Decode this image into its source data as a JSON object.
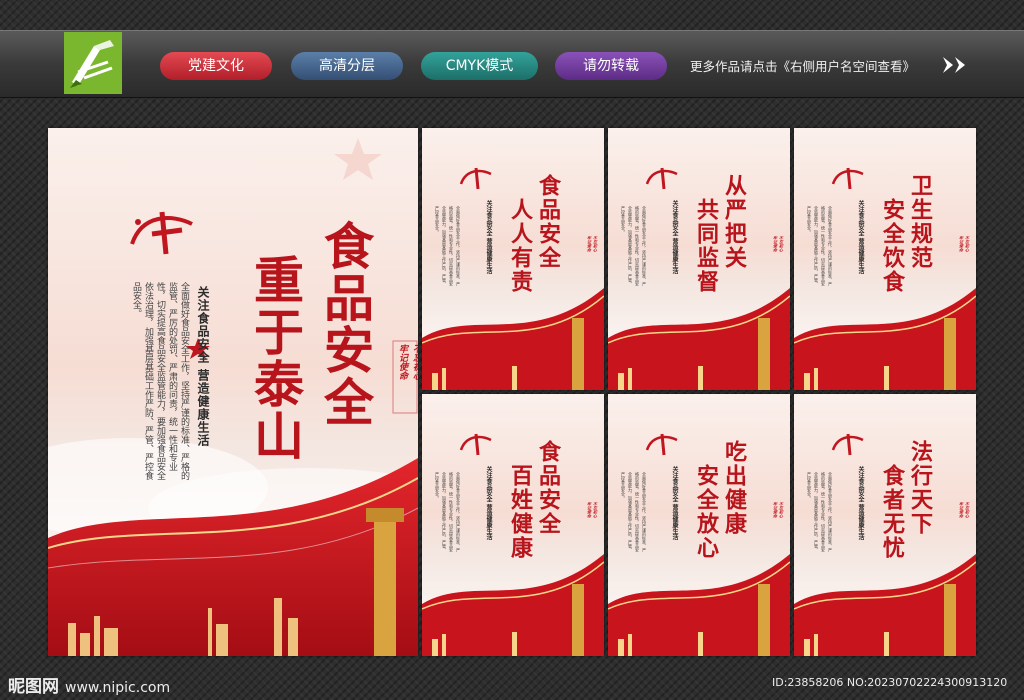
{
  "header": {
    "tags": [
      "党建文化",
      "高清分层",
      "CMYK模式",
      "请勿转载"
    ],
    "more_text": "更多作品请点击《右侧用户名空间查看》",
    "colors": {
      "tag1": "#c42a33",
      "tag2": "#4a6a91",
      "tag3": "#279088",
      "tag4": "#743f9f",
      "logo": "#7ab72f"
    }
  },
  "main_poster": {
    "title_line1": "食品安全",
    "title_line2": "重于泰山",
    "subtitle": "关注食品安全 营造健康生活",
    "body": "全面做好食品安全工作，坚持严谨的标准、严格的监管、严厉的处罚、严肃的问责，统一性和专业性，切实提高食品安全监管能力，要加强食品安全依法治理，加强基层基础工作严防、严管、严控食品安全。",
    "seal_left": "不忘初心",
    "seal_right": "牢记使命"
  },
  "small_posters": [
    {
      "line1": "食品安全",
      "line2": "人人有责"
    },
    {
      "line1": "从严把关",
      "line2": "共同监督"
    },
    {
      "line1": "卫生规范",
      "line2": "安全饮食"
    },
    {
      "line1": "食品安全",
      "line2": "百姓健康"
    },
    {
      "line1": "吃出健康",
      "line2": "安全放心"
    },
    {
      "line1": "法行天下",
      "line2": "食者无忧"
    }
  ],
  "small_common": {
    "subtitle": "关注食品安全 营造健康生活",
    "body": "全面做好食品安全工作，坚持严谨的标准、严格的监管，统一性和专业性，切实提高食品安全监管能力，加强基层基础工作严防、严管、严控食品安全。",
    "seal_left": "不忘初心",
    "seal_right": "牢记使命"
  },
  "footer": {
    "brand": "昵图网",
    "site": "www.nipic.com",
    "id_text": "ID:23858206 NO:20230702224300913120"
  }
}
